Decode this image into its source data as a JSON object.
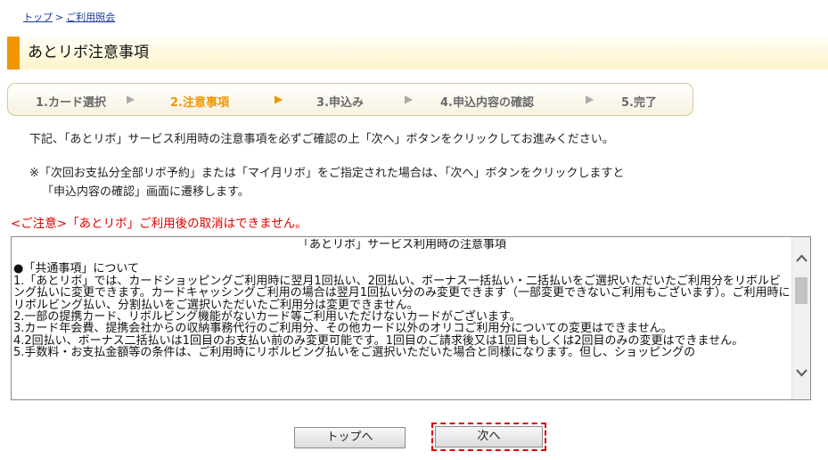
{
  "breadcrumb": {
    "top_link": "トップ",
    "separator": ">",
    "current_link": "ご利用照会"
  },
  "page_title": "あとリボ注意事項",
  "steps": [
    {
      "label": "1.カード選択",
      "active": false
    },
    {
      "label": "2.注意事項",
      "active": true
    },
    {
      "label": "3.申込み",
      "active": false
    },
    {
      "label": "4.申込内容の確認",
      "active": false
    },
    {
      "label": "5.完了",
      "active": false
    }
  ],
  "step_arrow": "▶",
  "intro_text": "下記、「あとリボ」サービス利用時の注意事項を必ずご確認の上「次へ」ボタンをクリックしてお進みください。",
  "note": {
    "line1": "※「次回お支払分全部リボ予約」または「マイ月リボ」をご指定された場合は、「次へ」ボタンをクリックしますと",
    "line2": "「申込内容の確認」画面に遷移します。"
  },
  "warning_text": "<ご注意>「あとリボ」ご利用後の取消はできません。",
  "terms": {
    "title": "「あとリボ」サービス利用時の注意事項",
    "section": "●「共通事項」について",
    "items": [
      "1.「あとリボ」では、カードショッピングご利用時に翌月1回払い、2回払い、ボーナス一括払い・二括払いをご選択いただいたご利用分をリボルビング払いに変更できます。カードキャッシングご利用の場合は翌月1回払い分のみ変更できます（一部変更できないご利用もございます）。ご利用時にリボルビング払い、分割払いをご選択いただいたご利用分は変更できません。",
      "2.一部の提携カード、リボルビング機能がないカード等ご利用いただけないカードがございます。",
      "3.カード年会費、提携会社からの収納事務代行のご利用分、その他カード以外のオリコご利用分についての変更はできません。",
      "4.2回払い、ボーナス二括払いは1回目のお支払い前のみ変更可能です。1回目のご請求後又は1回目もしくは2回目のみの変更はできません。",
      "5.手数料・お支払金額等の条件は、ご利用時にリボルビング払いをご選択いただいた場合と同様になります。但し、ショッピングの"
    ],
    "scroll_up_icon": "chevron-up-icon",
    "scroll_down_icon": "chevron-down-icon"
  },
  "buttons": {
    "top_label": "トップへ",
    "next_label": "次へ"
  },
  "colors": {
    "accent": "#f29600",
    "warning": "#e00000",
    "link": "#1a3a9c",
    "focus_outline": "#d40000"
  }
}
